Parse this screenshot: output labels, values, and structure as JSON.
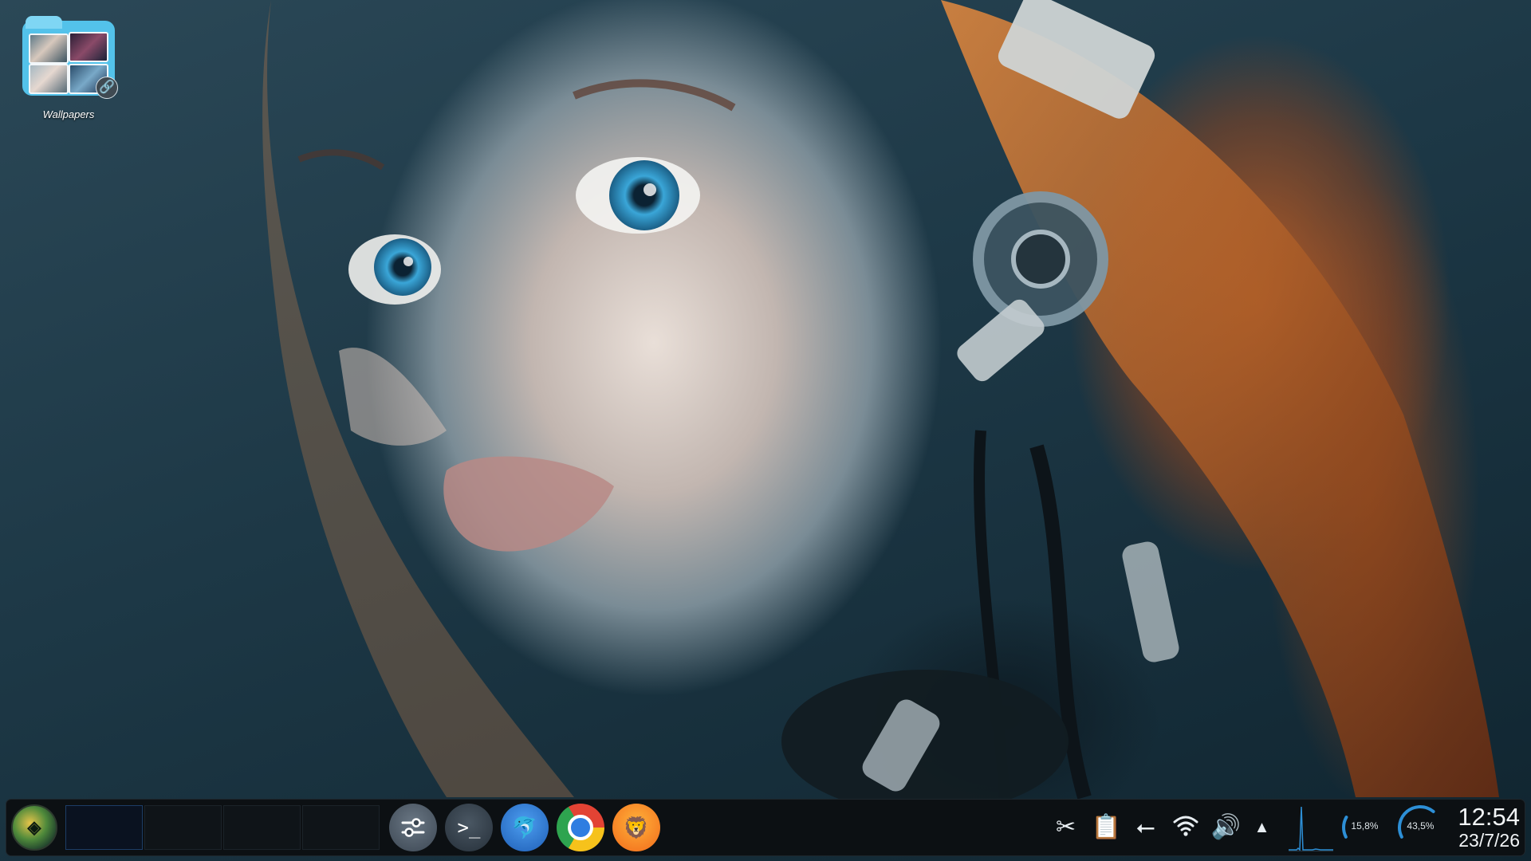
{
  "desktop": {
    "icons": [
      {
        "label": "Wallpapers",
        "icon": "folder-link-icon"
      }
    ]
  },
  "taskbar": {
    "launcher": {
      "icon": "app-launcher-icon"
    },
    "virtual_desktops": [
      {
        "active": true
      },
      {
        "active": false
      },
      {
        "active": false
      },
      {
        "active": false
      }
    ],
    "apps": [
      {
        "name": "System Settings",
        "icon": "settings-sliders-icon",
        "glyph": "⚙"
      },
      {
        "name": "Terminal",
        "icon": "terminal-icon",
        "glyph": ">_"
      },
      {
        "name": "Dolphin",
        "icon": "dolphin-file-manager-icon",
        "glyph": "🐬"
      },
      {
        "name": "Google Chrome",
        "icon": "chrome-icon"
      },
      {
        "name": "Brave",
        "icon": "brave-lion-icon",
        "glyph": "🦁"
      }
    ],
    "tray": [
      {
        "icon": "scissors-icon",
        "glyph": "✂"
      },
      {
        "icon": "clipboard-icon",
        "glyph": "📋"
      },
      {
        "icon": "usb-icon",
        "glyph": "⭠"
      },
      {
        "icon": "wifi-icon",
        "glyph": "📶"
      },
      {
        "icon": "volume-icon",
        "glyph": "🔊"
      }
    ],
    "tray_expand_glyph": "▲",
    "monitors": {
      "cpu_percent_text": "15,8%",
      "cpu_fraction": 0.158,
      "memory_percent_text": "43,5%",
      "memory_fraction": 0.435,
      "accent_color": "#2d8fd6"
    },
    "clock": {
      "time": "12:54",
      "date": "23/7/26"
    }
  }
}
